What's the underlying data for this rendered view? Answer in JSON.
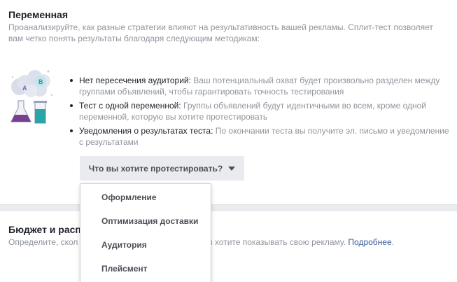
{
  "section": {
    "title": "Переменная",
    "description": "Проанализируйте, как разные стратегии влияют на результативность вашей рекламы. Сплит-тест позволяет вам четко понять результаты благодаря следующим методикам:",
    "illustration_labels": {
      "a": "A",
      "b": "B"
    },
    "bullets": [
      {
        "head": "Нет пересечения аудиторий:",
        "text": " Ваш потенциальный охват будет произвольно разделен между группами объявлений, чтобы гарантировать точность тестирования"
      },
      {
        "head": "Тест с одной переменной:",
        "text": " Группы объявлений будут идентичными во всем, кроме одной переменной, которую вы хотите протестировать"
      },
      {
        "head": "Уведомления о результатах теста:",
        "text": " По окончании теста вы получите эл. письмо и уведомление с результатами"
      }
    ],
    "dropdown_label": "Что вы хотите протестировать?"
  },
  "menu": {
    "items": [
      "Оформление",
      "Оптимизация доставки",
      "Аудитория",
      "Плейсмент"
    ]
  },
  "budget": {
    "title_visible": "Бюджет и расп",
    "desc_left": "Определите, скол",
    "desc_right": "ы хотите показывать свою рекламу.",
    "link": "Подробнее",
    "period": "."
  },
  "colors": {
    "text_primary": "#1d2129",
    "text_secondary": "#90949c",
    "button_bg": "#e9ebee",
    "link": "#365899"
  }
}
